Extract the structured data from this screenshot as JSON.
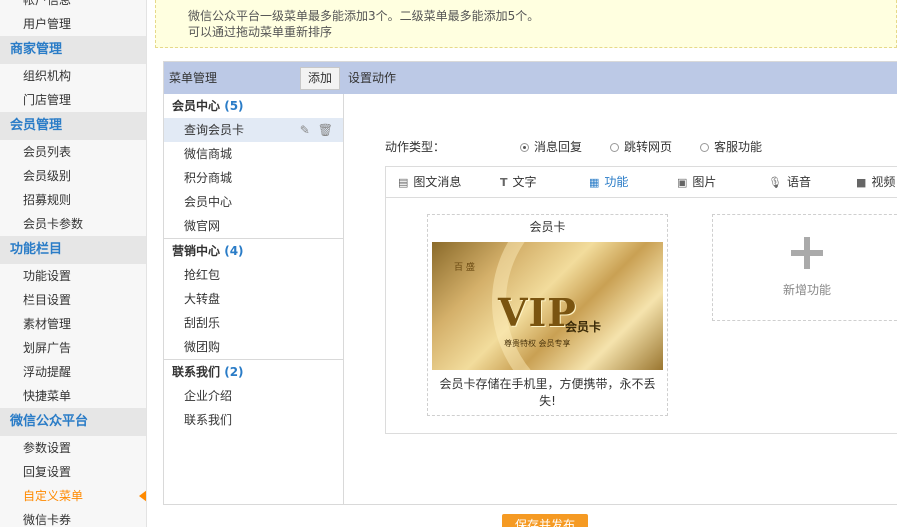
{
  "sidebar": {
    "groups": [
      {
        "title": null,
        "items": [
          "帐户信息",
          "用户管理"
        ]
      },
      {
        "title": "商家管理",
        "items": [
          "组织机构",
          "门店管理"
        ]
      },
      {
        "title": "会员管理",
        "items": [
          "会员列表",
          "会员级别",
          "招募规则",
          "会员卡参数"
        ]
      },
      {
        "title": "功能栏目",
        "items": [
          "功能设置",
          "栏目设置",
          "素材管理",
          "划屏广告",
          "浮动提醒",
          "快捷菜单"
        ]
      },
      {
        "title": "微信公众平台",
        "items": [
          "参数设置",
          "回复设置",
          "自定义菜单",
          "微信卡券"
        ]
      }
    ],
    "active_item": "自定义菜单"
  },
  "notice": {
    "line1": "微信公众平台一级菜单最多能添加3个。二级菜单最多能添加5个。",
    "line2": "可以通过拖动菜单重新排序"
  },
  "toolbar": {
    "title": "菜单管理",
    "add_label": "添加",
    "action_label": "设置动作"
  },
  "menu_groups": [
    {
      "name": "会员中心",
      "count": "(5)",
      "items": [
        "查询会员卡",
        "微信商城",
        "积分商城",
        "会员中心",
        "微官网"
      ]
    },
    {
      "name": "营销中心",
      "count": "(4)",
      "items": [
        "抢红包",
        "大转盘",
        "刮刮乐",
        "微团购"
      ]
    },
    {
      "name": "联系我们",
      "count": "(2)",
      "items": [
        "企业介绍",
        "联系我们"
      ]
    }
  ],
  "selected_menu_item": "查询会员卡",
  "action": {
    "label": "动作类型：",
    "options": [
      "消息回复",
      "跳转网页",
      "客服功能"
    ],
    "selected": "消息回复"
  },
  "tabs": [
    {
      "label": "图文消息",
      "icon": "news-icon"
    },
    {
      "label": "文字",
      "icon": "text-icon"
    },
    {
      "label": "功能",
      "icon": "grid-icon"
    },
    {
      "label": "图片",
      "icon": "image-icon"
    },
    {
      "label": "语音",
      "icon": "microphone-icon"
    },
    {
      "label": "视频",
      "icon": "video-icon"
    }
  ],
  "active_tab": "功能",
  "card": {
    "title": "会员卡",
    "brand": "百 盛",
    "vip_text": "VIP",
    "vip_sub": "会员卡",
    "tagline": "尊贵特权  会员专享",
    "desc": "会员卡存储在手机里，方便携带，永不丢失!"
  },
  "new_function": {
    "label": "新增功能"
  },
  "save_button": {
    "label": "保存并发布"
  },
  "colors": {
    "accent": "#2a7cc7",
    "active_orange": "#ff8a00",
    "toolbar_bg": "#bcc9e6",
    "notice_bg": "#ffffe0",
    "save_bg": "#f59a23"
  }
}
